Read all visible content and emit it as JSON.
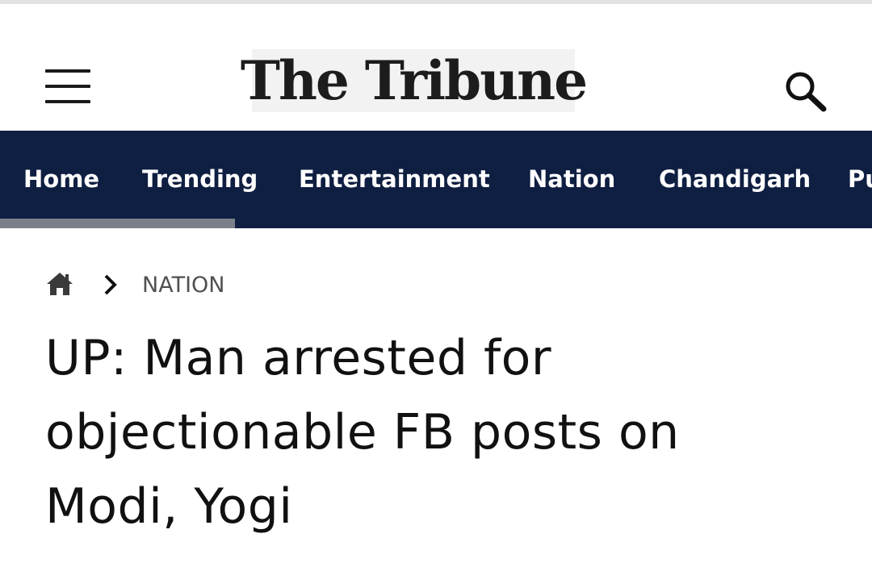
{
  "header": {
    "logo_text": "The Tribune",
    "menu_icon": "hamburger-menu-icon",
    "search_icon": "search-icon"
  },
  "nav": {
    "items": [
      {
        "label": "Home"
      },
      {
        "label": "Trending"
      },
      {
        "label": "Entertainment"
      },
      {
        "label": "Nation"
      },
      {
        "label": "Chandigarh"
      },
      {
        "label": "Pu"
      }
    ],
    "background": "#0f1f42"
  },
  "breadcrumb": {
    "home_icon": "home-icon",
    "separator_icon": "chevron-right-icon",
    "section": "NATION"
  },
  "article": {
    "headline": "UP: Man arrested for objectionable FB posts on Modi, Yogi"
  }
}
